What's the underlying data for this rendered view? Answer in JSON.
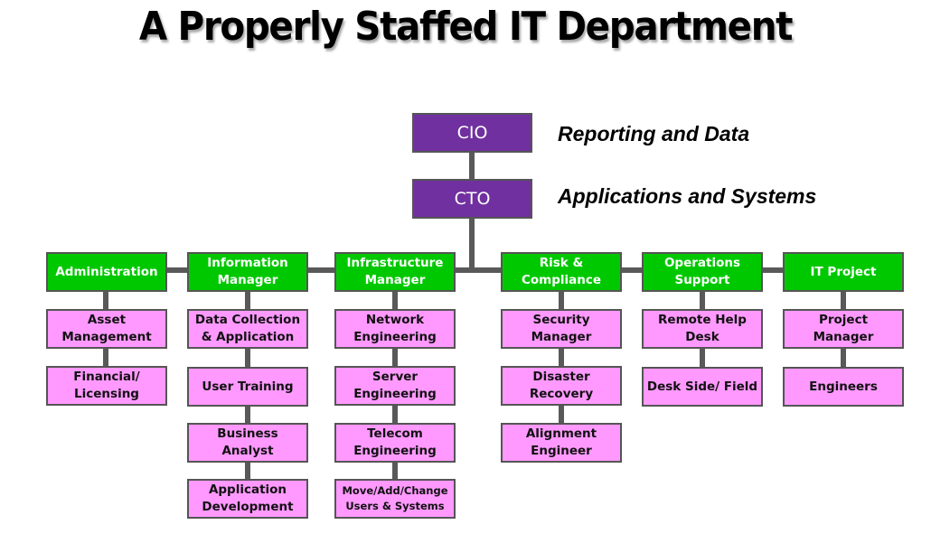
{
  "title": "A Properly Staffed IT Department",
  "executives": [
    {
      "label": "CIO",
      "note": "Reporting and Data"
    },
    {
      "label": "CTO",
      "note": "Applications and Systems"
    }
  ],
  "departments": [
    {
      "label": "Administration",
      "roles": [
        "Asset Management",
        "Financial/ Licensing"
      ]
    },
    {
      "label": "Information Manager",
      "roles": [
        "Data Collection & Application",
        "User Training",
        "Business Analyst",
        "Application Development"
      ]
    },
    {
      "label": "Infrastructure Manager",
      "roles": [
        "Network Engineering",
        "Server Engineering",
        "Telecom Engineering",
        "Move/Add/Change Users & Systems"
      ]
    },
    {
      "label": "Risk & Compliance",
      "roles": [
        "Security Manager",
        "Disaster Recovery",
        "Alignment Engineer"
      ]
    },
    {
      "label": "Operations Support",
      "roles": [
        "Remote Help Desk",
        "Desk Side/ Field"
      ]
    },
    {
      "label": "IT Project",
      "roles": [
        "Project Manager",
        "Engineers"
      ]
    }
  ],
  "colors": {
    "executive": "#7030a0",
    "department": "#00c800",
    "role": "#ff99ff",
    "connector": "#595959"
  }
}
